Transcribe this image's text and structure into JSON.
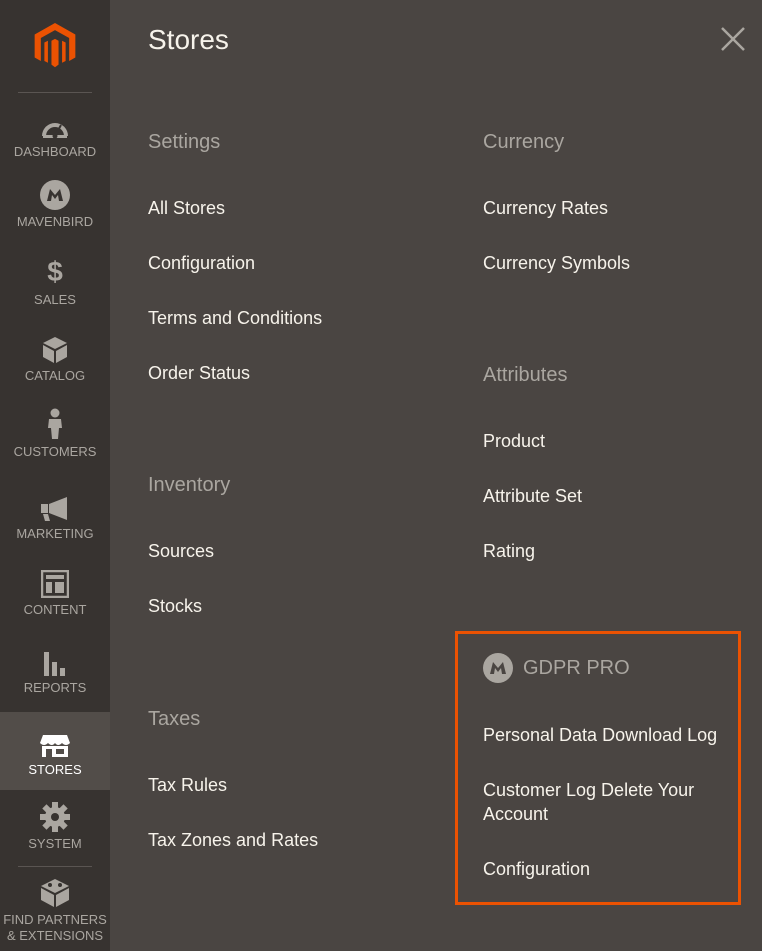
{
  "sidebar": {
    "items": [
      {
        "label": "DASHBOARD",
        "icon": "dashboard-icon"
      },
      {
        "label": "MAVENBIRD",
        "icon": "mavenbird-icon"
      },
      {
        "label": "SALES",
        "icon": "dollar-icon"
      },
      {
        "label": "CATALOG",
        "icon": "cube-icon"
      },
      {
        "label": "CUSTOMERS",
        "icon": "person-icon"
      },
      {
        "label": "MARKETING",
        "icon": "megaphone-icon"
      },
      {
        "label": "CONTENT",
        "icon": "layout-icon"
      },
      {
        "label": "REPORTS",
        "icon": "bar-chart-icon"
      },
      {
        "label": "STORES",
        "icon": "storefront-icon"
      },
      {
        "label": "SYSTEM",
        "icon": "gear-icon"
      },
      {
        "label": "FIND PARTNERS",
        "label2": "& EXTENSIONS",
        "icon": "blocks-icon"
      }
    ]
  },
  "panel": {
    "title": "Stores",
    "settings": {
      "title": "Settings",
      "links": [
        "All Stores",
        "Configuration",
        "Terms and Conditions",
        "Order Status"
      ]
    },
    "inventory": {
      "title": "Inventory",
      "links": [
        "Sources",
        "Stocks"
      ]
    },
    "taxes": {
      "title": "Taxes",
      "links": [
        "Tax Rules",
        "Tax Zones and Rates"
      ]
    },
    "currency": {
      "title": "Currency",
      "links": [
        "Currency Rates",
        "Currency Symbols"
      ]
    },
    "attributes": {
      "title": "Attributes",
      "links": [
        "Product",
        "Attribute Set",
        "Rating"
      ]
    },
    "gdpr": {
      "title": "GDPR PRO",
      "links": [
        "Personal Data Download Log",
        "Customer Log Delete Your",
        "Account",
        "Configuration"
      ]
    }
  },
  "colors": {
    "accent": "#eb5202",
    "sidebar_bg": "#373330",
    "panel_bg": "#4a4542",
    "active_bg": "#524d49"
  }
}
